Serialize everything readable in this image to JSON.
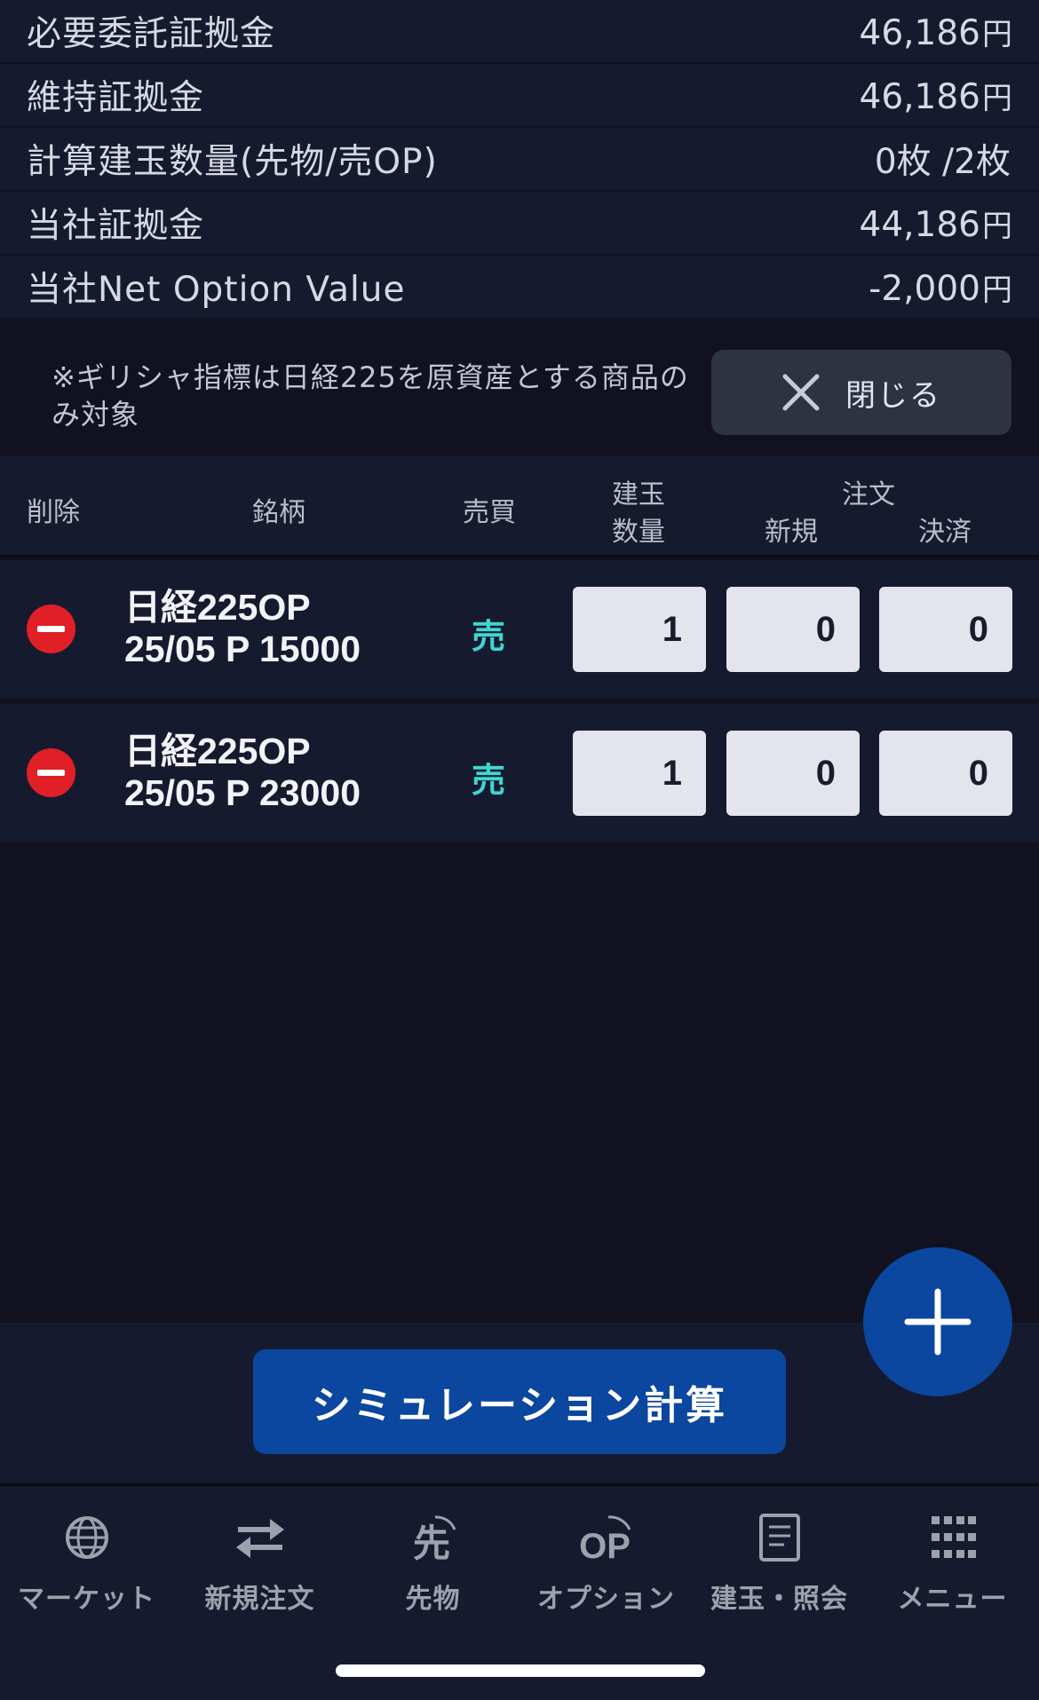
{
  "summary": {
    "rows": [
      {
        "label": "必要委託証拠金",
        "value": "46,186",
        "unit": "円"
      },
      {
        "label": "維持証拠金",
        "value": "46,186",
        "unit": "円"
      },
      {
        "label": "計算建玉数量(先物/売OP)",
        "value": "0枚 /2枚",
        "unit": ""
      },
      {
        "label": "当社証拠金",
        "value": "44,186",
        "unit": "円"
      },
      {
        "label": "当社Net Option Value",
        "value": "-2,000",
        "unit": "円"
      }
    ]
  },
  "note": {
    "text": "※ギリシャ指標は日経225を原資産とする商品のみ対象",
    "close_label": "閉じる"
  },
  "table": {
    "headers": {
      "delete": "削除",
      "symbol": "銘柄",
      "side": "売買",
      "position_line1": "建玉",
      "position_line2": "数量",
      "order": "注文",
      "new": "新規",
      "settle": "決済"
    },
    "rows": [
      {
        "name_line1": "日経225OP",
        "name_line2": "25/05 P 15000",
        "side": "売",
        "position": "1",
        "new": "0",
        "settle": "0"
      },
      {
        "name_line1": "日経225OP",
        "name_line2": "25/05 P 23000",
        "side": "売",
        "position": "1",
        "new": "0",
        "settle": "0"
      }
    ]
  },
  "actions": {
    "simulate_label": "シミュレーション計算"
  },
  "tabbar": {
    "items": [
      {
        "label": "マーケット",
        "icon": "globe-icon"
      },
      {
        "label": "新規注文",
        "icon": "swap-arrows-icon"
      },
      {
        "label": "先物",
        "icon": "futures-icon"
      },
      {
        "label": "オプション",
        "icon": "option-icon"
      },
      {
        "label": "建玉・照会",
        "icon": "document-icon"
      },
      {
        "label": "メニュー",
        "icon": "grid-menu-icon"
      }
    ]
  },
  "colors": {
    "background": "#11111f",
    "panel": "#161a2e",
    "accent_blue": "#0b469f",
    "sell_teal": "#3fd6d2",
    "delete_red": "#e01f26"
  }
}
